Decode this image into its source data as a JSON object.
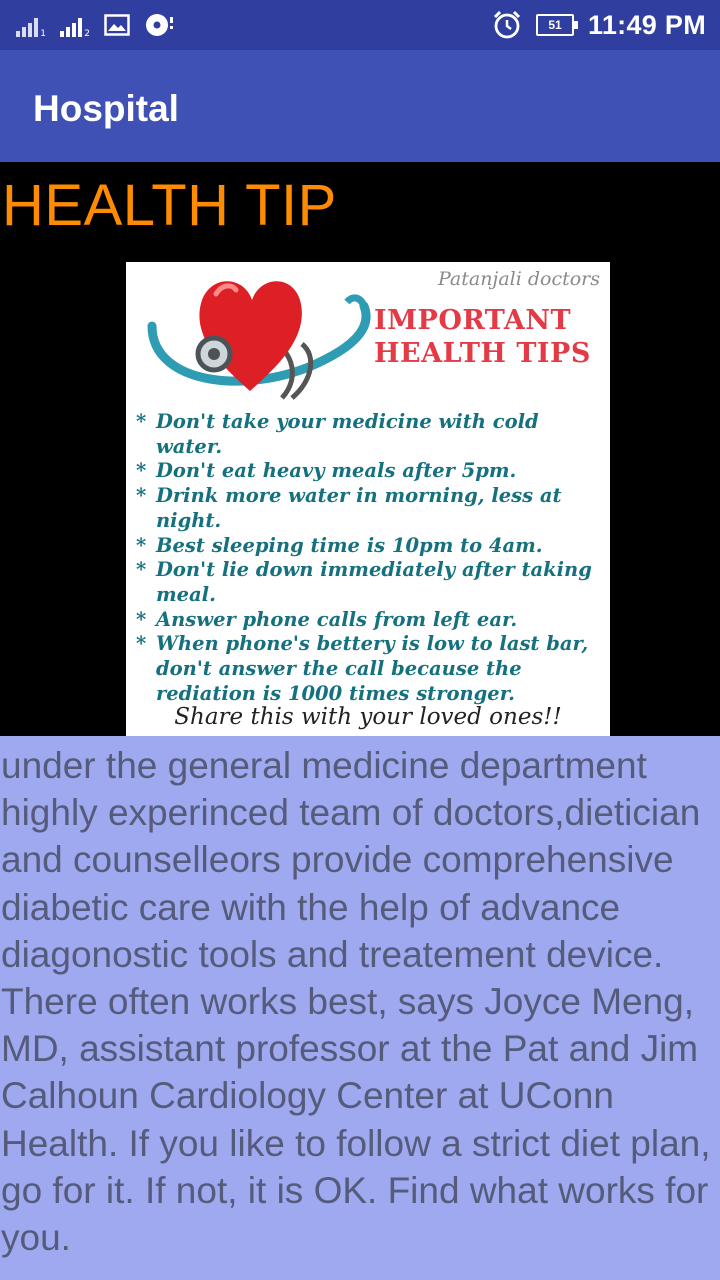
{
  "status_bar": {
    "sim1_label": "1",
    "sim2_label": "2",
    "battery_level": "51",
    "time": "11:49 PM"
  },
  "app_bar": {
    "title": "Hospital"
  },
  "content": {
    "heading": "HEALTH TIP",
    "tip_image": {
      "watermark": "Patanjali doctors",
      "title": "IMPORTANT HEALTH TIPS",
      "tips": [
        "Don't take your medicine with cold water.",
        "Don't eat heavy meals after 5pm.",
        "Drink more water in morning, less at night.",
        "Best sleeping time is 10pm to 4am.",
        "Don't lie down immediately after taking meal.",
        "Answer phone calls from left ear.",
        "When phone's bettery is low to last bar, don't answer the call because the rediation is 1000 times stronger."
      ],
      "footer": "Share this with your loved ones!!"
    },
    "description": "under the general medicine department highly experinced team of doctors,dietician and counselleors provide comprehensive diabetic care with the help of advance diagonostic tools and treatement device. There often works best, says Joyce Meng, MD, assistant professor at the Pat and Jim Calhoun Cardiology Center at UConn Health. If you like to follow a strict diet plan, go for it. If not, it is OK. Find what works for you."
  },
  "colors": {
    "status_bar": "#303f9f",
    "app_bar": "#3f51b5",
    "heading": "#ff8c00",
    "description_bg": "#9fa9ef",
    "description_text": "#555b7a"
  }
}
